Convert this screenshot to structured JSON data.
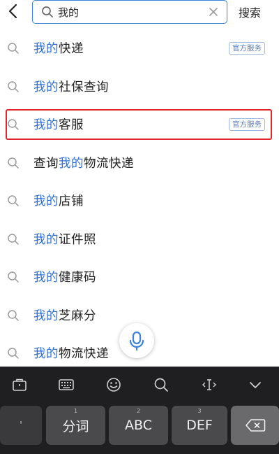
{
  "header": {
    "query": "我的",
    "search_label": "搜索"
  },
  "suggestions": [
    {
      "highlight": "我的",
      "prefix": "",
      "suffix": "快递",
      "badge": "官方服务"
    },
    {
      "highlight": "我的",
      "prefix": "",
      "suffix": "社保查询",
      "badge": ""
    },
    {
      "highlight": "我的",
      "prefix": "",
      "suffix": "客服",
      "badge": "官方服务",
      "selected": true
    },
    {
      "highlight": "我的",
      "prefix": "查询",
      "suffix": "物流快递",
      "badge": ""
    },
    {
      "highlight": "我的",
      "prefix": "",
      "suffix": "店铺",
      "badge": ""
    },
    {
      "highlight": "我的",
      "prefix": "",
      "suffix": "证件照",
      "badge": ""
    },
    {
      "highlight": "我的",
      "prefix": "",
      "suffix": "健康码",
      "badge": ""
    },
    {
      "highlight": "我的",
      "prefix": "",
      "suffix": "芝麻分",
      "badge": ""
    },
    {
      "highlight": "我的",
      "prefix": "",
      "suffix": "物流快递",
      "badge": ""
    }
  ],
  "keyboard": {
    "toolbar_icons": [
      "briefcase-icon",
      "keyboard-icon",
      "emoji-icon",
      "search-icon",
      "cursor-icon",
      "chevron-down-icon"
    ],
    "keys": [
      {
        "label": "'",
        "sub": ""
      },
      {
        "label": "分词",
        "sub": "1"
      },
      {
        "label": "ABC",
        "sub": "2"
      },
      {
        "label": "DEF",
        "sub": "3"
      },
      {
        "label": "",
        "sub": ""
      }
    ]
  },
  "colors": {
    "highlight": "#2f6fd8",
    "accent_border": "#3a82e0",
    "selection_frame": "#e0262b",
    "keyboard_bg": "#1f1f21"
  }
}
